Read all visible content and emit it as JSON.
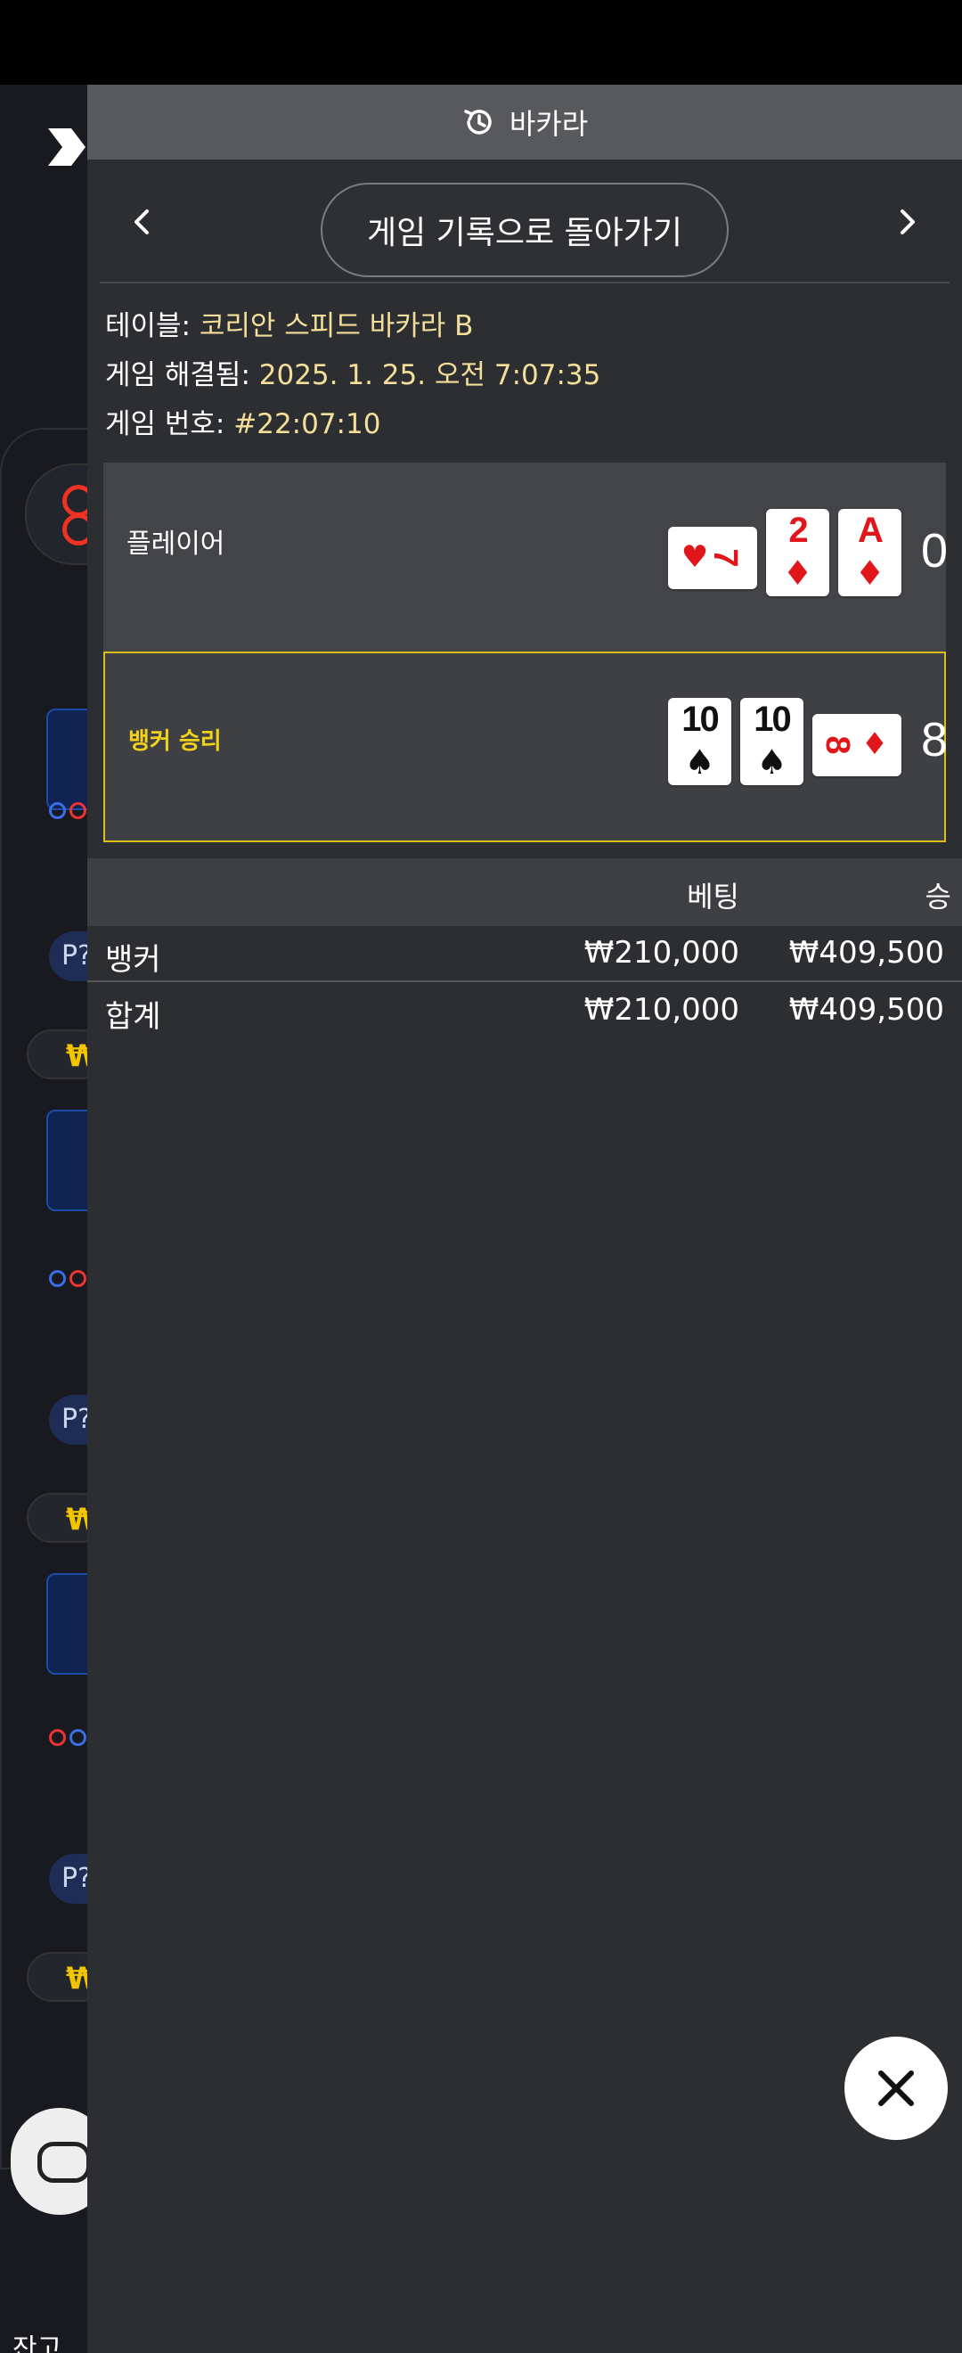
{
  "background_app": {
    "balance_label": "잔고",
    "pill_text": "P?",
    "currency_symbol": "₩"
  },
  "panel": {
    "header_title": "바카라",
    "header_icon": "history-icon",
    "back_label": "게임 기록으로 돌아가기",
    "info": {
      "table_label": "테이블:",
      "table_value": "코리안 스피드 바카라 B",
      "resolved_label": "게임 해결됨:",
      "resolved_value": "2025. 1. 25. 오전 7:07:35",
      "game_no_label": "게임 번호:",
      "game_no_value": "#22:07:10"
    },
    "player": {
      "label": "플레이어",
      "score": "0",
      "cards": [
        {
          "rank": "7",
          "suit": "♥",
          "color": "red",
          "orientation": "sideways"
        },
        {
          "rank": "2",
          "suit": "♦",
          "color": "red",
          "orientation": "upright"
        },
        {
          "rank": "A",
          "suit": "♦",
          "color": "red",
          "orientation": "upright"
        }
      ]
    },
    "banker": {
      "label": "뱅커 승리",
      "score": "8",
      "highlight_color": "#d9be1e",
      "cards": [
        {
          "rank": "10",
          "suit": "♠",
          "color": "black",
          "orientation": "upright"
        },
        {
          "rank": "10",
          "suit": "♠",
          "color": "black",
          "orientation": "upright"
        },
        {
          "rank": "8",
          "suit": "♦",
          "color": "red",
          "orientation": "sideways"
        }
      ]
    },
    "table": {
      "col_bet": "베팅",
      "col_win": "승",
      "rows": [
        {
          "label": "뱅커",
          "bet": "₩210,000",
          "win": "₩409,500"
        },
        {
          "label": "합계",
          "bet": "₩210,000",
          "win": "₩409,500"
        }
      ]
    }
  }
}
